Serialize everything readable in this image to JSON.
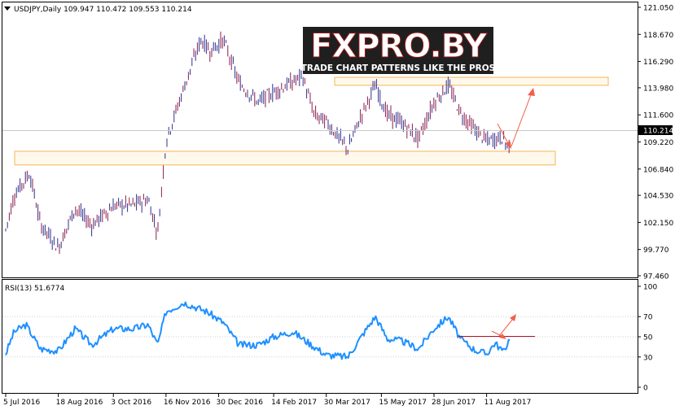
{
  "chart_title": "USDJPY,Daily  109.947 110.472 109.553 110.214",
  "watermark": {
    "logo": "FXPRO.BY",
    "tagline": "TRADE CHART PATTERNS LIKE THE PROS"
  },
  "price_axis": {
    "ticks": [
      "121.050",
      "118.670",
      "116.290",
      "113.980",
      "111.600",
      "109.220",
      "106.840",
      "104.530",
      "102.150",
      "99.770",
      "97.460"
    ],
    "current_price_label": "110.214"
  },
  "rsi": {
    "label": "RSI(13) 51.6774",
    "ticks": [
      "100",
      "70",
      "50",
      "30",
      "0"
    ]
  },
  "date_axis": {
    "labels": [
      "5 Jul 2016",
      "18 Aug 2016",
      "3 Oct 2016",
      "16 Nov 2016",
      "30 Dec 2016",
      "14 Feb 2017",
      "30 Mar 2017",
      "15 May 2017",
      "28 Jun 2017",
      "11 Aug 2017"
    ]
  },
  "colors": {
    "bull": "#2f2f8f",
    "bear": "#8a1f4f",
    "rsi_line": "#1e90ff",
    "zone_fill": "#fff4dc",
    "zone_stroke": "#f5b45a",
    "arrow": "#f0604a",
    "grid": "#cfcfcf"
  },
  "chart_data": {
    "type": "candlestick",
    "symbol": "USDJPY",
    "timeframe": "Daily",
    "last_ohlc": {
      "open": 109.947,
      "high": 110.472,
      "low": 109.553,
      "close": 110.214
    },
    "price_range": [
      97.46,
      121.05
    ],
    "path_points": [
      {
        "date": "5 Jul 2016",
        "price": 101.5
      },
      {
        "date": "12 Jul 2016",
        "price": 104.5
      },
      {
        "date": "25 Jul 2016",
        "price": 106.5
      },
      {
        "date": "3 Aug 2016",
        "price": 102.0
      },
      {
        "date": "18 Aug 2016",
        "price": 99.9
      },
      {
        "date": "1 Sep 2016",
        "price": 103.4
      },
      {
        "date": "15 Sep 2016",
        "price": 101.9
      },
      {
        "date": "3 Oct 2016",
        "price": 103.6
      },
      {
        "date": "20 Oct 2016",
        "price": 103.7
      },
      {
        "date": "1 Nov 2016",
        "price": 104.2
      },
      {
        "date": "9 Nov 2016",
        "price": 101.2
      },
      {
        "date": "16 Nov 2016",
        "price": 109.3
      },
      {
        "date": "1 Dec 2016",
        "price": 114.0
      },
      {
        "date": "15 Dec 2016",
        "price": 118.2
      },
      {
        "date": "23 Dec 2016",
        "price": 117.2
      },
      {
        "date": "3 Jan 2017",
        "price": 118.2
      },
      {
        "date": "16 Jan 2017",
        "price": 114.4
      },
      {
        "date": "1 Feb 2017",
        "price": 112.7
      },
      {
        "date": "14 Feb 2017",
        "price": 113.6
      },
      {
        "date": "2 Mar 2017",
        "price": 114.5
      },
      {
        "date": "10 Mar 2017",
        "price": 115.0
      },
      {
        "date": "20 Mar 2017",
        "price": 111.6
      },
      {
        "date": "30 Mar 2017",
        "price": 111.0
      },
      {
        "date": "17 Apr 2017",
        "price": 108.6
      },
      {
        "date": "28 Apr 2017",
        "price": 111.5
      },
      {
        "date": "10 May 2017",
        "price": 114.2
      },
      {
        "date": "20 May 2017",
        "price": 111.6
      },
      {
        "date": "1 Jun 2017",
        "price": 110.9
      },
      {
        "date": "15 Jun 2017",
        "price": 109.5
      },
      {
        "date": "28 Jun 2017",
        "price": 112.7
      },
      {
        "date": "10 Jul 2017",
        "price": 114.2
      },
      {
        "date": "20 Jul 2017",
        "price": 111.8
      },
      {
        "date": "1 Aug 2017",
        "price": 110.3
      },
      {
        "date": "11 Aug 2017",
        "price": 109.3
      },
      {
        "date": "18 Aug 2017",
        "price": 109.5
      },
      {
        "date": "25 Aug 2017",
        "price": 109.6
      },
      {
        "date": "29 Aug 2017",
        "price": 108.5
      },
      {
        "date": "31 Aug 2017",
        "price": 110.2
      }
    ],
    "zones": [
      {
        "price_top": 114.9,
        "price_bottom": 114.2,
        "date_from": "30 Mar 2017",
        "date_to": "1 Oct 2017"
      },
      {
        "price_top": 108.4,
        "price_bottom": 107.2,
        "date_from": "5 Jul 2016",
        "date_to": "1 Oct 2017"
      }
    ],
    "rsi": {
      "period": 13,
      "last_value": 51.6774,
      "range": [
        0,
        100
      ],
      "levels": [
        70,
        50,
        30
      ],
      "path_points": [
        {
          "date": "5 Jul 2016",
          "value": 33
        },
        {
          "date": "12 Jul 2016",
          "value": 55
        },
        {
          "date": "22 Jul 2016",
          "value": 62
        },
        {
          "date": "3 Aug 2016",
          "value": 38
        },
        {
          "date": "18 Aug 2016",
          "value": 36
        },
        {
          "date": "1 Sep 2016",
          "value": 58
        },
        {
          "date": "15 Sep 2016",
          "value": 42
        },
        {
          "date": "3 Oct 2016",
          "value": 58
        },
        {
          "date": "20 Oct 2016",
          "value": 58
        },
        {
          "date": "1 Nov 2016",
          "value": 62
        },
        {
          "date": "9 Nov 2016",
          "value": 42
        },
        {
          "date": "16 Nov 2016",
          "value": 75
        },
        {
          "date": "1 Dec 2016",
          "value": 84
        },
        {
          "date": "20 Dec 2016",
          "value": 75
        },
        {
          "date": "3 Jan 2017",
          "value": 64
        },
        {
          "date": "16 Jan 2017",
          "value": 42
        },
        {
          "date": "1 Feb 2017",
          "value": 42
        },
        {
          "date": "14 Feb 2017",
          "value": 50
        },
        {
          "date": "2 Mar 2017",
          "value": 55
        },
        {
          "date": "20 Mar 2017",
          "value": 40
        },
        {
          "date": "30 Mar 2017",
          "value": 32
        },
        {
          "date": "17 Apr 2017",
          "value": 30
        },
        {
          "date": "1 May 2017",
          "value": 55
        },
        {
          "date": "10 May 2017",
          "value": 70
        },
        {
          "date": "20 May 2017",
          "value": 48
        },
        {
          "date": "1 Jun 2017",
          "value": 46
        },
        {
          "date": "15 Jun 2017",
          "value": 38
        },
        {
          "date": "28 Jun 2017",
          "value": 58
        },
        {
          "date": "10 Jul 2017",
          "value": 70
        },
        {
          "date": "20 Jul 2017",
          "value": 48
        },
        {
          "date": "1 Aug 2017",
          "value": 37
        },
        {
          "date": "11 Aug 2017",
          "value": 33
        },
        {
          "date": "18 Aug 2017",
          "value": 44
        },
        {
          "date": "25 Aug 2017",
          "value": 35
        },
        {
          "date": "29 Aug 2017",
          "value": 45
        },
        {
          "date": "31 Aug 2017",
          "value": 51.68
        }
      ],
      "trendline_value": 50
    }
  }
}
